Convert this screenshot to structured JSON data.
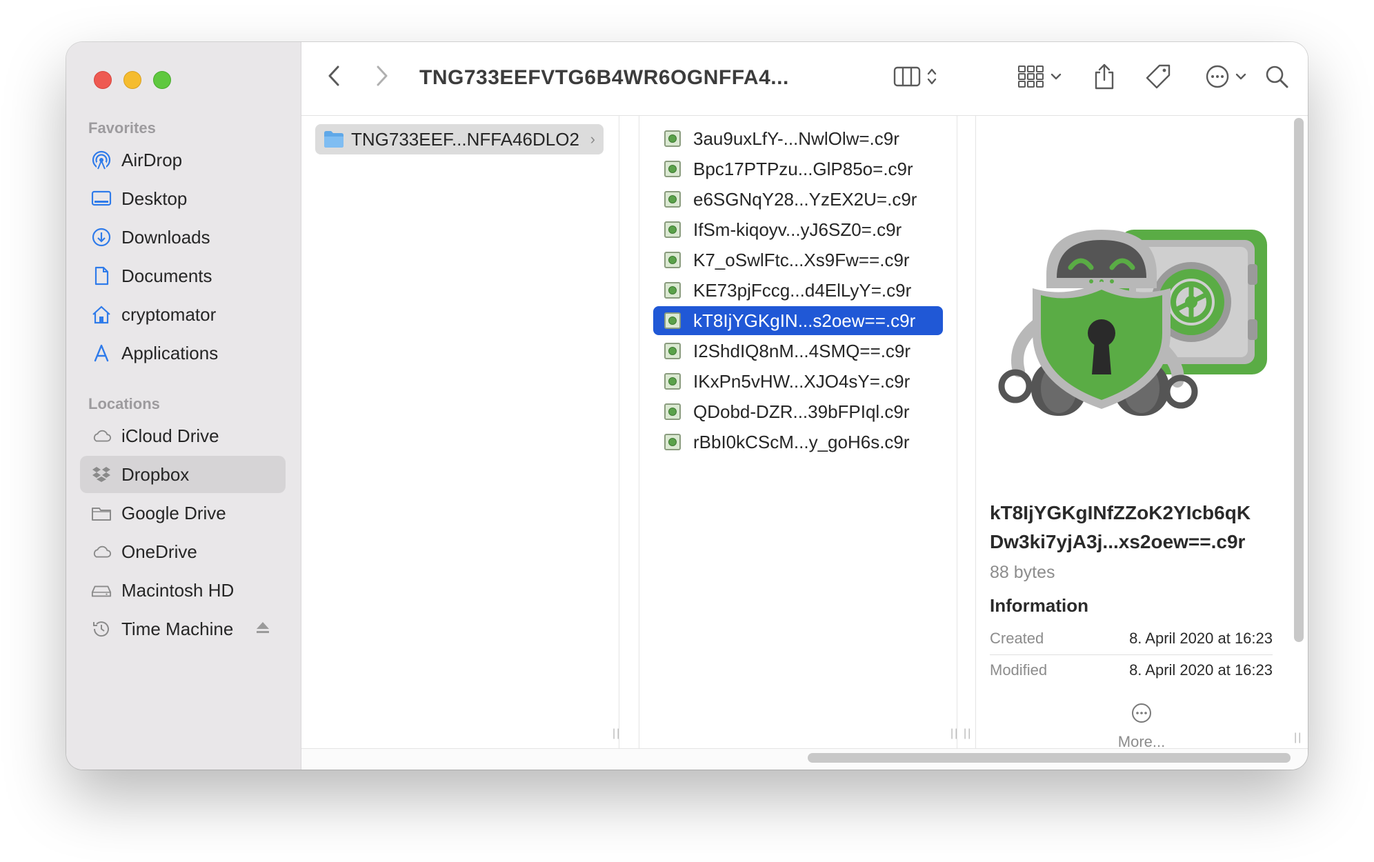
{
  "window": {
    "title": "TNG733EEFVTG6B4WR6OGNFFA4..."
  },
  "sidebar": {
    "favorites_header": "Favorites",
    "favorites": [
      {
        "label": "AirDrop",
        "icon": "airdrop-icon"
      },
      {
        "label": "Desktop",
        "icon": "desktop-icon"
      },
      {
        "label": "Downloads",
        "icon": "downloads-icon"
      },
      {
        "label": "Documents",
        "icon": "document-icon"
      },
      {
        "label": "cryptomator",
        "icon": "home-icon"
      },
      {
        "label": "Applications",
        "icon": "applications-icon"
      }
    ],
    "locations_header": "Locations",
    "locations": [
      {
        "label": "iCloud Drive",
        "icon": "cloud-icon"
      },
      {
        "label": "Dropbox",
        "icon": "dropbox-icon",
        "selected": true
      },
      {
        "label": "Google Drive",
        "icon": "folder-icon"
      },
      {
        "label": "OneDrive",
        "icon": "cloud-icon"
      },
      {
        "label": "Macintosh HD",
        "icon": "disk-icon"
      },
      {
        "label": "Time Machine",
        "icon": "time-machine-icon",
        "ejectable": true
      }
    ]
  },
  "column1": {
    "folder_name": "TNG733EEF...NFFA46DLO2"
  },
  "column2": {
    "files": [
      "3au9uxLfY-...NwlOlw=.c9r",
      "Bpc17PTPzu...GlP85o=.c9r",
      "e6SGNqY28...YzEX2U=.c9r",
      "IfSm-kiqoyv...yJ6SZ0=.c9r",
      "K7_oSwlFtc...Xs9Fw==.c9r",
      "KE73pjFccg...d4ElLyY=.c9r",
      "kT8IjYGKgIN...s2oew==.c9r",
      "I2ShdIQ8nM...4SMQ==.c9r",
      "IKxPn5vHW...XJO4sY=.c9r",
      "QDobd-DZR...39bFPIql.c9r",
      "rBbI0kCScM...y_goH6s.c9r"
    ],
    "selected_index": 6
  },
  "preview": {
    "name_line1": "kT8IjYGKgINfZZoK2YIcb6qK",
    "name_line2": "Dw3ki7yjA3j...xs2oew==.c9r",
    "size": "88 bytes",
    "info_header": "Information",
    "created_label": "Created",
    "created_value": "8. April 2020 at 16:23",
    "modified_label": "Modified",
    "modified_value": "8. April 2020 at 16:23",
    "more_label": "More..."
  },
  "colors": {
    "selection": "#2058d6",
    "accent_blue": "#2f7bea",
    "cryptomator_green": "#5aac45"
  }
}
